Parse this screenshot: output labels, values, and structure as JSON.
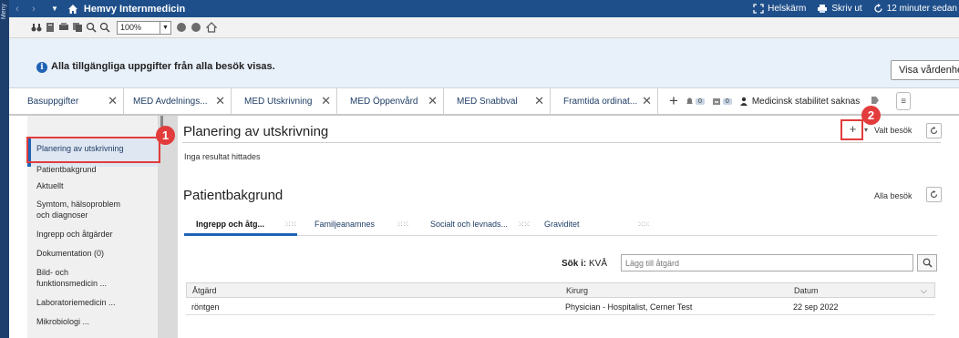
{
  "app": {
    "menu_label": "Meny",
    "title": "Hemvy Internmedicin",
    "fullscreen_label": "Helskärm",
    "print_label": "Skriv ut",
    "refresh_label": "12 minuter sedan"
  },
  "toolbar": {
    "zoom_value": "100%"
  },
  "banner": {
    "message": "Alla tillgängliga uppgifter från alla besök visas.",
    "button_label": "Visa vårdenheter"
  },
  "tabs": [
    {
      "label": "Basuppgifter"
    },
    {
      "label": "MED Avdelnings..."
    },
    {
      "label": "MED Utskrivning"
    },
    {
      "label": "MED Öppenvård"
    },
    {
      "label": "MED Snabbval"
    },
    {
      "label": "Framtida ordinat..."
    }
  ],
  "tab_extras": {
    "count_a": "0",
    "count_b": "0",
    "warning_label": "Medicinsk stabilitet saknas"
  },
  "leftnav": {
    "items": [
      {
        "label": "Planering av utskrivning"
      },
      {
        "label": "Patientbakgrund"
      },
      {
        "label": "Aktuellt"
      },
      {
        "label": "Symtom, hälsoproblem"
      },
      {
        "label": "och diagnoser"
      },
      {
        "label": "Ingrepp och åtgärder"
      },
      {
        "label": "Dokumentation (0)"
      },
      {
        "label": "Bild- och"
      },
      {
        "label": "funktionsmedicin ..."
      },
      {
        "label": "Laboratoriemedicin ..."
      },
      {
        "label": "Mikrobiologi ..."
      }
    ]
  },
  "annotations": {
    "marker_1": "1",
    "marker_2": "2"
  },
  "planering": {
    "title": "Planering av utskrivning",
    "add_label": "+",
    "scope_label": "Valt besök",
    "empty_text": "Inga resultat hittades"
  },
  "patientbakgrund": {
    "title": "Patientbakgrund",
    "scope_label": "Alla besök",
    "subtabs": [
      {
        "label": "Ingrepp och åtg..."
      },
      {
        "label": "Familjeanamnes"
      },
      {
        "label": "Socialt och levnads..."
      },
      {
        "label": "Graviditet"
      }
    ],
    "search_prefix": "Sök i:",
    "search_scope": "KVÅ",
    "search_placeholder": "Lägg till åtgärd",
    "columns": [
      "Åtgärd",
      "Kirurg",
      "Datum"
    ],
    "rows": [
      {
        "atgard": "röntgen",
        "kirurg": "Physician - Hospitalist, Cerner Test",
        "datum": "22 sep 2022"
      }
    ]
  }
}
